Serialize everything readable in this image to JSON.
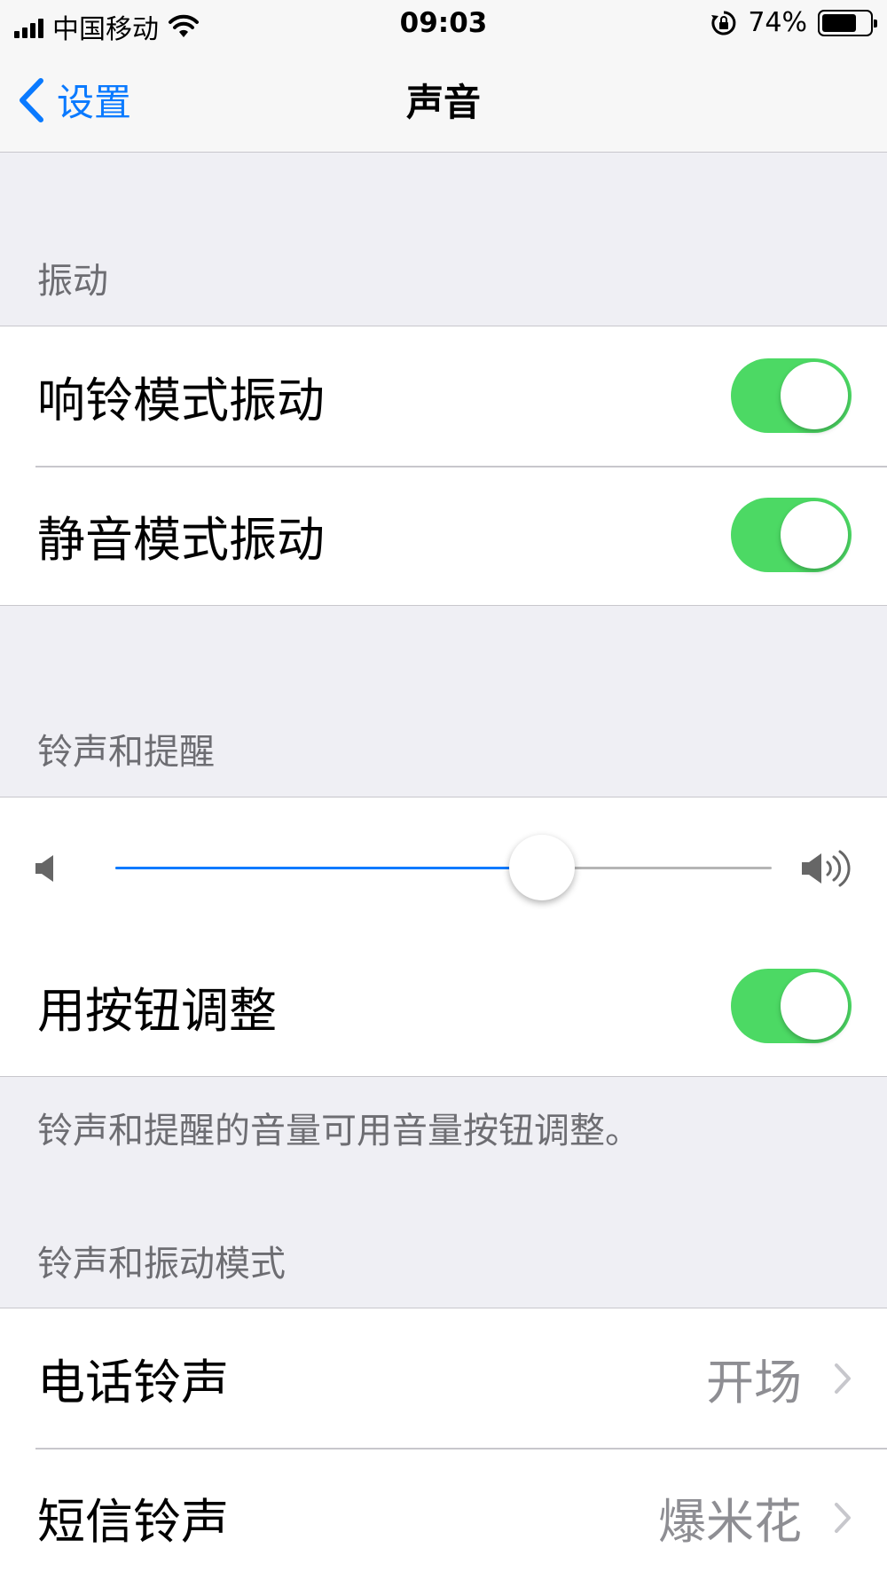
{
  "status_bar": {
    "carrier": "中国移动",
    "time": "09:03",
    "battery_percent": "74%",
    "battery_level": 0.74
  },
  "nav": {
    "back_label": "设置",
    "title": "声音"
  },
  "sections": {
    "vibration": {
      "header": "振动",
      "rows": [
        {
          "label": "响铃模式振动",
          "on": true
        },
        {
          "label": "静音模式振动",
          "on": true
        }
      ]
    },
    "ringer": {
      "header": "铃声和提醒",
      "volume_level": 0.65,
      "buttons_row": {
        "label": "用按钮调整",
        "on": true
      },
      "footer": "铃声和提醒的音量可用音量按钮调整。"
    },
    "patterns": {
      "header": "铃声和振动模式",
      "rows": [
        {
          "label": "电话铃声",
          "value": "开场"
        },
        {
          "label": "短信铃声",
          "value": "爆米花"
        }
      ]
    }
  },
  "colors": {
    "accent": "#0a7aff",
    "toggle_on": "#4cd964",
    "background": "#efeff4"
  }
}
